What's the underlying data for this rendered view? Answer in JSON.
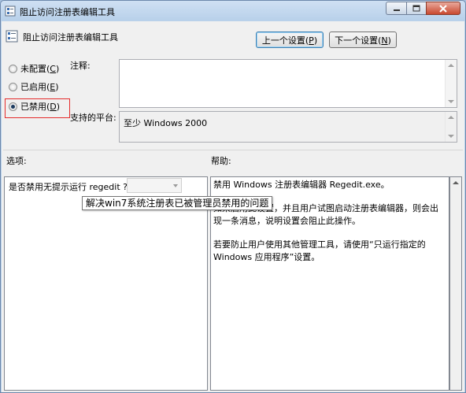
{
  "window": {
    "title": "阻止访问注册表编辑工具",
    "icon": "policy-setting-icon",
    "colors": {
      "title_bar": "#b9d1ea",
      "client": "#f0f0f0",
      "close_button": "#c9482f",
      "highlight_box": "#e52b2b"
    }
  },
  "header": {
    "setting_title": "阻止访问注册表编辑工具",
    "previous_button": {
      "text": "上一个设置(",
      "key": "P",
      "tail": ")"
    },
    "next_button": {
      "text": "下一个设置(",
      "key": "N",
      "tail": ")"
    }
  },
  "state_options": [
    {
      "text": "未配置(",
      "key": "C",
      "tail": ")",
      "selected": false
    },
    {
      "text": "已启用(",
      "key": "E",
      "tail": ")",
      "selected": false
    },
    {
      "text": "已禁用(",
      "key": "D",
      "tail": ")",
      "selected": true
    }
  ],
  "comment": {
    "label": "注释:",
    "value": ""
  },
  "supported_on": {
    "label": "支持的平台:",
    "value": "至少 Windows 2000"
  },
  "options": {
    "label": "选项:",
    "prompt": "是否禁用无提示运行 regedit ?",
    "combo_value": ""
  },
  "help": {
    "label": "帮助:",
    "paragraphs": [
      "禁用 Windows 注册表编辑器 Regedit.exe。",
      "如果启用此设置，并且用户试图启动注册表编辑器，则会出现一条消息，说明设置会阻止此操作。",
      "若要防止用户使用其他管理工具，请使用“只运行指定的 Windows 应用程序”设置。"
    ]
  },
  "tooltip": {
    "text": "解决win7系统注册表已被管理员禁用的问题"
  }
}
